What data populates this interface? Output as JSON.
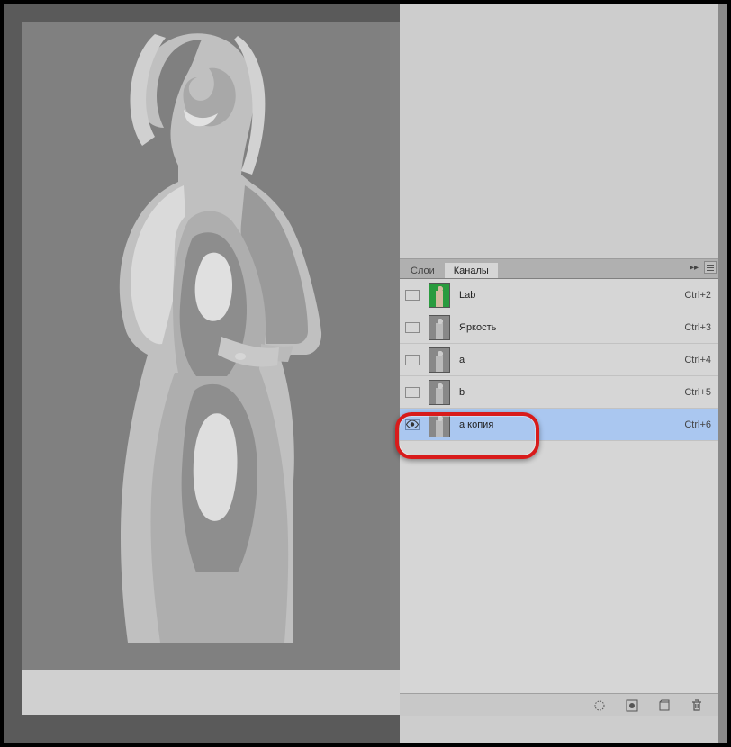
{
  "tabs": {
    "layers": "Слои",
    "channels": "Каналы"
  },
  "channels": [
    {
      "label": "Lab",
      "shortcut": "Ctrl+2",
      "visible": false,
      "thumb": "color"
    },
    {
      "label": "Яркость",
      "shortcut": "Ctrl+3",
      "visible": false,
      "thumb": "gray"
    },
    {
      "label": "a",
      "shortcut": "Ctrl+4",
      "visible": false,
      "thumb": "gray"
    },
    {
      "label": "b",
      "shortcut": "Ctrl+5",
      "visible": false,
      "thumb": "gray"
    },
    {
      "label": "a копия",
      "shortcut": "Ctrl+6",
      "visible": true,
      "thumb": "gray",
      "selected": true
    }
  ]
}
